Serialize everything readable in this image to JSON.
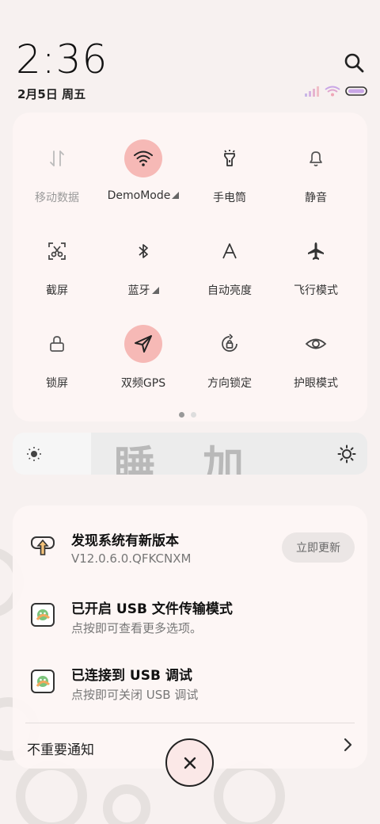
{
  "status": {
    "time": "2:36",
    "date": "2月5日 周五"
  },
  "quick_settings": {
    "tiles": [
      {
        "label": "移动数据",
        "icon": "mobile-data-icon",
        "active": false,
        "dim": true
      },
      {
        "label": "DemoMode",
        "icon": "wifi-icon",
        "active": true,
        "has_arrow": true
      },
      {
        "label": "手电筒",
        "icon": "flashlight-icon",
        "active": false
      },
      {
        "label": "静音",
        "icon": "bell-icon",
        "active": false
      },
      {
        "label": "截屏",
        "icon": "screenshot-icon",
        "active": false
      },
      {
        "label": "蓝牙",
        "icon": "bluetooth-icon",
        "active": false,
        "has_arrow": true
      },
      {
        "label": "自动亮度",
        "icon": "auto-brightness-icon",
        "active": false
      },
      {
        "label": "飞行模式",
        "icon": "airplane-icon",
        "active": false
      },
      {
        "label": "锁屏",
        "icon": "lock-icon",
        "active": false
      },
      {
        "label": "双频GPS",
        "icon": "gps-icon",
        "active": true
      },
      {
        "label": "方向锁定",
        "icon": "rotation-lock-icon",
        "active": false
      },
      {
        "label": "护眼模式",
        "icon": "eye-icon",
        "active": false
      }
    ],
    "page_index": 0,
    "page_count": 2
  },
  "brightness": {
    "watermark": "睡加",
    "level": 0.22
  },
  "notifications": [
    {
      "title": "发现系统有新版本",
      "subtitle": "V12.0.6.0.QFKCNXM",
      "action": "立即更新",
      "icon": "update-icon"
    },
    {
      "title": "已开启 USB 文件传输模式",
      "subtitle": "点按即可查看更多选项。",
      "icon": "android-system-icon"
    },
    {
      "title": "已连接到 USB 调试",
      "subtitle": "点按即可关闭 USB 调试",
      "icon": "android-system-icon"
    }
  ],
  "footer": {
    "unimportant_label": "不重要通知"
  },
  "colors": {
    "accent_active": "#f6b9b6",
    "panel_bg": "#fdf5f4"
  }
}
